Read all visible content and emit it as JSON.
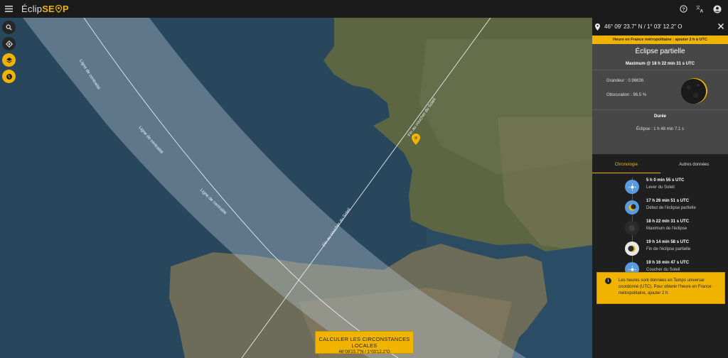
{
  "app": {
    "logo_left": "Éclip",
    "logo_right": "SE",
    "logo_tail": "P"
  },
  "icons": {
    "menu": "menu-icon",
    "help": "help-icon",
    "translate": "translate-icon",
    "account": "account-icon",
    "search": "search-icon",
    "locate": "crosshair-icon",
    "layers": "layers-icon",
    "globe": "globe-icon",
    "pin": "location-pin-icon",
    "close": "close-icon",
    "info": "info-icon"
  },
  "colors": {
    "accent": "#f0b400",
    "panel": "#1f1f1f",
    "summary_bg": "#474747"
  },
  "map": {
    "labels": [
      "Ligne de centralité",
      "Ligne de centralité",
      "Ligne de centralité",
      "Fin au coucher du Soleil",
      "Fin au coucher du Soleil"
    ],
    "calc_button": {
      "title": "CALCULER LES CIRCONSTANCES LOCALES",
      "coords": "46°09'23.7\"N / 1°03'12.2\"O"
    }
  },
  "panel": {
    "coords": "46° 09' 23.7\" N / 1° 03' 12.2\" O",
    "timezone": "Heure en France métropolitaine : ajouter 2 h à UTC",
    "title": "Éclipse partielle",
    "maximum": "Maximum @ 18 h 22 min 31 s UTC",
    "grandeur": "Grandeur : 0.96636",
    "obscuration": "Obscuration : 96.5 %",
    "duree_label": "Durée",
    "eclipse_duration": "Éclipse : 1 h 48 min 7.1 s",
    "tabs": [
      "Chronologie",
      "Autres données"
    ],
    "events": [
      {
        "time": "5 h 0 min 55 s UTC",
        "label": "Lever du Soleil",
        "icon": "sunrise-icon"
      },
      {
        "time": "17 h 26 min 51 s UTC",
        "label": "Début de l'éclipse partielle",
        "icon": "partial-start-icon"
      },
      {
        "time": "18 h 22 min 31 s UTC",
        "label": "Maximum de l'éclipse",
        "icon": "eclipse-max-icon"
      },
      {
        "time": "19 h 14 min 58 s UTC",
        "label": "Fin de l'éclipse partielle",
        "icon": "partial-end-icon"
      },
      {
        "time": "19 h 16 min 47 s UTC",
        "label": "Coucher du Soleil",
        "icon": "sunset-icon"
      }
    ],
    "note": "Les heures sont données en Temps universel coordonné (UTC). Pour obtenir l'heure en France métropolitaine, ajouter 2 h."
  }
}
